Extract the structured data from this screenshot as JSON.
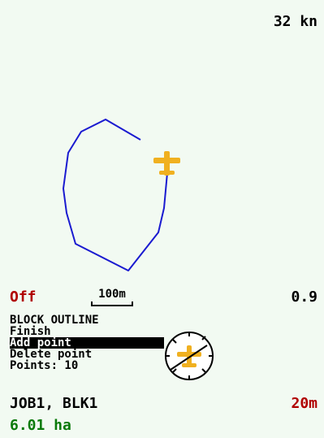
{
  "status_bar": {
    "speed": "32 kn"
  },
  "map": {
    "outline_color": "#1a1ad0",
    "aircraft_color": "#f0b020",
    "aircraft_icon": "airplane-icon"
  },
  "info_row": {
    "gps_status": "Off",
    "scale_label": "100m",
    "ratio": "0.9"
  },
  "menu": {
    "title": "BLOCK OUTLINE",
    "items": [
      "Finish",
      "Add point",
      "Delete point"
    ],
    "selected_index": 1,
    "points_label": "Points: 10"
  },
  "compass": {
    "icon": "compass-icon"
  },
  "footer": {
    "job": "JOB1, BLK1",
    "swath_width": "20m",
    "area": "6.01 ha"
  },
  "colors": {
    "background": "#f2faf2",
    "status_red": "#b00000",
    "area_green": "#0a7a0a"
  }
}
